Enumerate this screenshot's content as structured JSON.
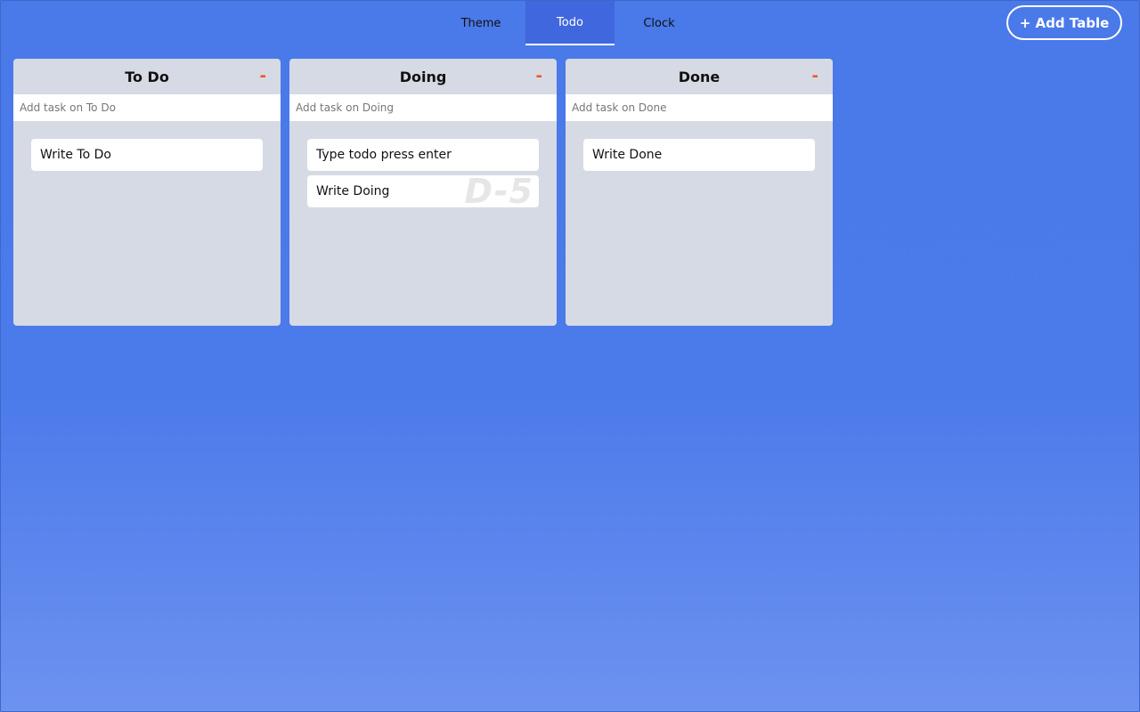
{
  "nav": {
    "tabs": [
      {
        "label": "Theme",
        "active": false
      },
      {
        "label": "Todo",
        "active": true
      },
      {
        "label": "Clock",
        "active": false
      }
    ]
  },
  "toolbar": {
    "add_table_label": "+ Add Table"
  },
  "boards": [
    {
      "title": "To Do",
      "remove_label": "-",
      "input_placeholder": "Add task on To Do",
      "tasks": [
        {
          "text": "Write To Do"
        }
      ]
    },
    {
      "title": "Doing",
      "remove_label": "-",
      "input_placeholder": "Add task on Doing",
      "tasks": [
        {
          "text": "Type todo press enter"
        },
        {
          "text": "Write Doing",
          "badge": "D-5"
        }
      ]
    },
    {
      "title": "Done",
      "remove_label": "-",
      "input_placeholder": "Add task on Done",
      "tasks": [
        {
          "text": "Write Done"
        }
      ]
    }
  ],
  "colors": {
    "background_top": "#4a79ea",
    "background_bottom": "#6d92f0",
    "active_tab": "#4067dd",
    "board": "#d6dae4",
    "remove": "#f0532a"
  }
}
